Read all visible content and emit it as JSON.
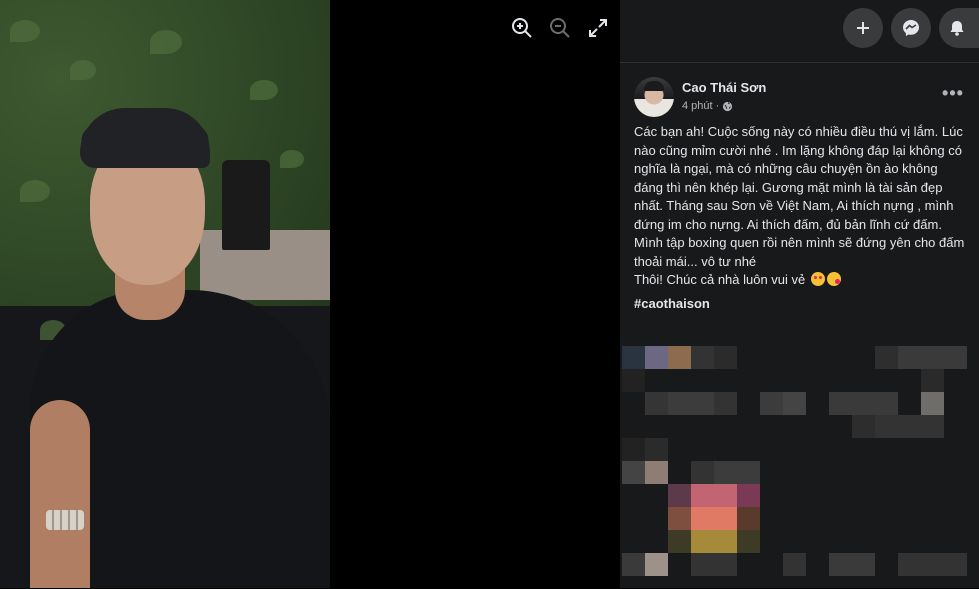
{
  "viewer": {
    "tools": [
      {
        "name": "zoom-in-icon"
      },
      {
        "name": "zoom-out-icon"
      },
      {
        "name": "fullscreen-icon"
      }
    ]
  },
  "header_actions": [
    {
      "name": "create-plus-icon"
    },
    {
      "name": "messenger-icon"
    },
    {
      "name": "notifications-bell-icon"
    }
  ],
  "post": {
    "author": "Cao Thái Sơn",
    "time": "4 phút",
    "privacy_icon": "globe-icon",
    "more_label": "•••",
    "body_lines": [
      "Các bạn ah! Cuộc sống này có nhiều điều thú vị lắm. Lúc nào cũng mỉm cười nhé . Im lặng không đáp lại không có nghĩa là ngại, mà có những câu chuyện ồn ào không đáng thì nên khép lại. Gương mặt mình là tài sản đẹp nhất. Tháng sau Sơn về Việt Nam, Ai thích nựng , mình đứng im cho nựng. Ai thích đấm, đủ bản lĩnh cứ đấm. Mình tập boxing quen rồi nên mình sẽ đứng yên cho đấm thoải mái... vô tư nhé",
      "Thôi! Chúc cả nhà luôn vui vẻ"
    ],
    "emojis": [
      "smiling-face-with-hearts",
      "face-blowing-kiss"
    ],
    "hashtag": "#caothaison"
  },
  "colors": {
    "panel_bg": "#18191a",
    "button_bg": "#3a3b3c",
    "text_primary": "#e4e6eb",
    "text_secondary": "#b0b3b8"
  }
}
